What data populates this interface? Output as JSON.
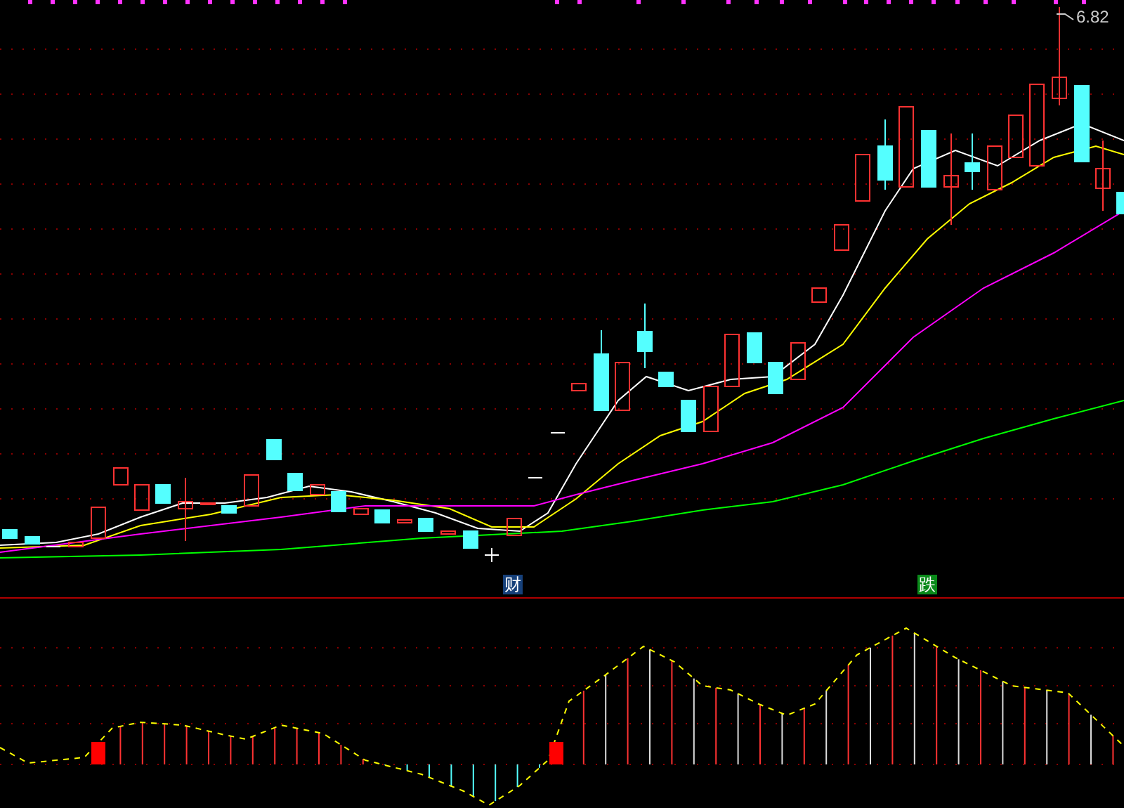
{
  "price_chart": {
    "high_label": "6.82",
    "signals": [
      {
        "label": "财",
        "color": "#16407a"
      },
      {
        "label": "跌",
        "color": "#0a8a1a"
      }
    ]
  }
}
